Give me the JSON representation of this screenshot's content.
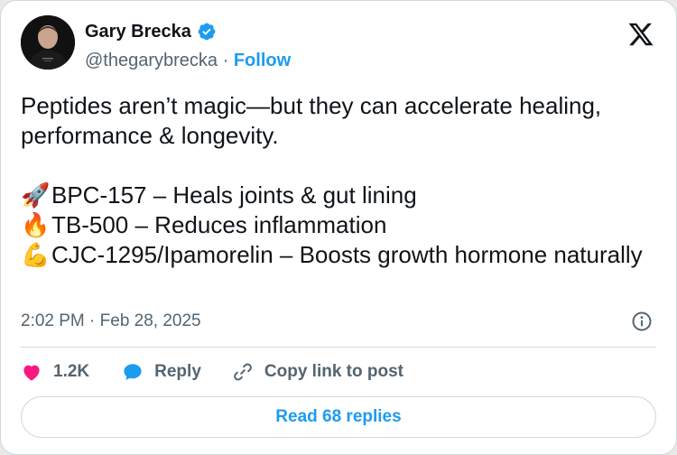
{
  "author": {
    "name": "Gary Brecka",
    "handle": "@thegarybrecka",
    "separator": "·",
    "follow_label": "Follow"
  },
  "tweet": {
    "intro": "Peptides aren’t magic—but they can accelerate healing, performance & longevity.",
    "items": [
      {
        "emoji": "🚀",
        "text": "BPC-157 – Heals joints & gut lining"
      },
      {
        "emoji": "🔥",
        "text": "TB-500 – Reduces inflammation"
      },
      {
        "emoji": "💪",
        "text": "CJC-1295/Ipamorelin – Boosts growth hormone naturally"
      }
    ],
    "timestamp": "2:02 PM · Feb 28, 2025"
  },
  "actions": {
    "like_count": "1.2K",
    "reply_label": "Reply",
    "copy_label": "Copy link to post"
  },
  "read_replies_label": "Read 68 replies",
  "colors": {
    "accent": "#1d9bf0",
    "like": "#f91880",
    "text": "#0f1419",
    "muted": "#536471",
    "border": "#cfd9de"
  },
  "icons": [
    "avatar",
    "verified-badge-icon",
    "x-logo-icon",
    "info-icon",
    "heart-icon",
    "reply-bubble-icon",
    "link-icon"
  ]
}
